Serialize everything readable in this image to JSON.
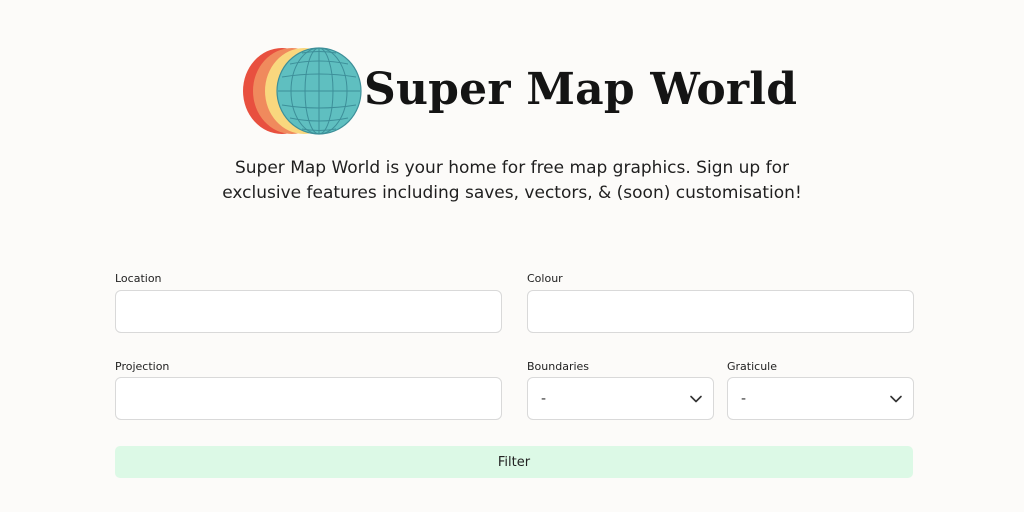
{
  "header": {
    "title": "Super Map World",
    "logo_icon": "globe-logo-icon",
    "tagline": "Super Map World is your home for free map graphics. Sign up for exclusive features including saves, vectors, & (soon) customisation!"
  },
  "filters": {
    "location": {
      "label": "Location",
      "value": "",
      "placeholder": ""
    },
    "colour": {
      "label": "Colour",
      "value": "",
      "placeholder": ""
    },
    "projection": {
      "label": "Projection",
      "value": "",
      "placeholder": ""
    },
    "boundaries": {
      "label": "Boundaries",
      "selected": "-",
      "icon": "chevron-down-icon"
    },
    "graticule": {
      "label": "Graticule",
      "selected": "-",
      "icon": "chevron-down-icon"
    },
    "filter_button_label": "Filter"
  },
  "colors": {
    "background": "#fcfbf9",
    "button": "#dcf9e6",
    "logo_red": "#e8503f",
    "logo_orange": "#f08a5d",
    "logo_yellow": "#f9d77e",
    "logo_teal": "#5fbfc0"
  }
}
